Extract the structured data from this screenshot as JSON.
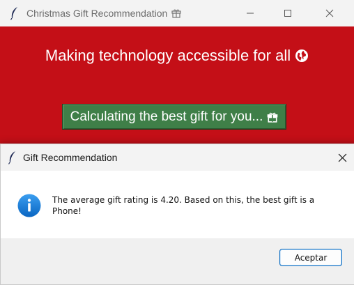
{
  "main_window": {
    "title": "Christmas Gift Recommendation",
    "headline": "Making technology accessible for all",
    "calc_button_label": "Calculating the best gift for you...",
    "colors": {
      "background": "#c40f17",
      "button": "#3f7f48"
    }
  },
  "dialog": {
    "title": "Gift Recommendation",
    "message": "The average gift rating is 4.20. Based on this, the best gift is a Phone!",
    "ok_label": "Aceptar",
    "icon": "info-icon",
    "colors": {
      "info_icon": "#1a7fd4",
      "ok_border": "#0067c0"
    }
  }
}
